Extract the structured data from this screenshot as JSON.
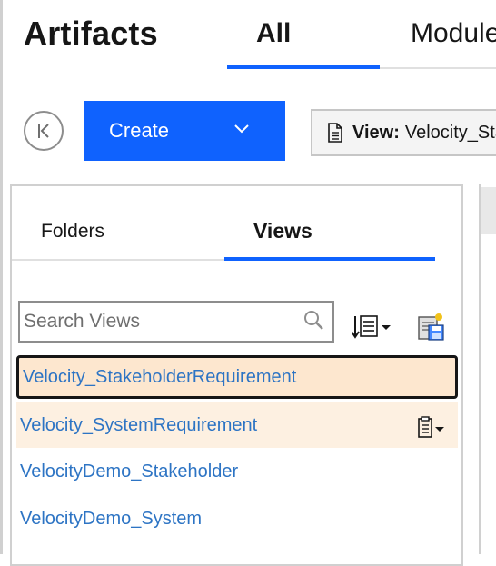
{
  "header": {
    "title": "Artifacts",
    "tabs": [
      {
        "label": "All",
        "active": true
      },
      {
        "label": "Modules",
        "active": false
      }
    ]
  },
  "toolbar": {
    "collapse_icon": "collapse-left-icon",
    "create_label": "Create",
    "create_icon": "chevron-down-icon",
    "view_prefix": "View:",
    "view_name": "Velocity_StakeholderRequirement",
    "view_icon": "document-icon"
  },
  "panel": {
    "tabs": [
      {
        "label": "Folders",
        "active": false
      },
      {
        "label": "Views",
        "active": true
      }
    ],
    "search": {
      "placeholder": "Search Views",
      "value": "",
      "icon": "search-icon"
    },
    "sort_icon": "sort-list-icon",
    "save_view_icon": "save-view-icon",
    "views": [
      {
        "label": "Velocity_StakeholderRequirement",
        "state": "selected"
      },
      {
        "label": "Velocity_SystemRequirement",
        "state": "hover"
      },
      {
        "label": "VelocityDemo_Stakeholder",
        "state": "normal"
      },
      {
        "label": "VelocityDemo_System",
        "state": "normal"
      }
    ]
  },
  "colors": {
    "accent": "#0f62fe",
    "link": "#2d74c4",
    "selected_bg": "#fde7cf",
    "hover_bg": "#fdf0e1"
  }
}
